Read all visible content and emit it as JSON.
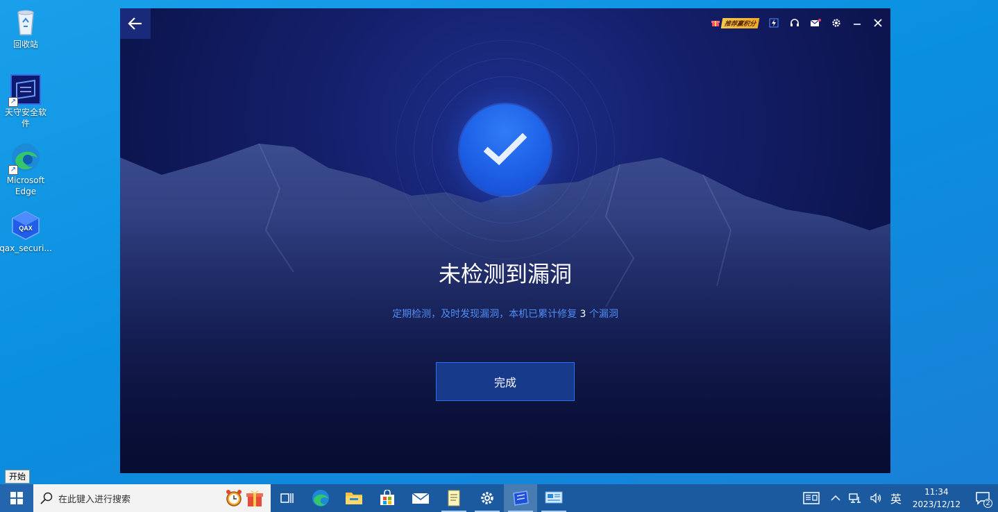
{
  "desktop": {
    "icons": [
      {
        "label": "回收站"
      },
      {
        "label": "天守安全软件"
      },
      {
        "label": "Microsoft Edge"
      },
      {
        "label": "qax_securi..."
      }
    ]
  },
  "app": {
    "promo_label": "推荐赢积分",
    "result_title": "未检测到漏洞",
    "subtitle_prefix": "定期检测，及时发现漏洞，本机已累计修复",
    "fixed_count": "3",
    "subtitle_suffix": "个漏洞",
    "done_button": "完成"
  },
  "taskbar": {
    "start_tooltip": "开始",
    "search_placeholder": "在此键入进行搜索",
    "ime_label": "英",
    "time": "11:34",
    "date": "2023/12/12",
    "notification_count": "2"
  },
  "colors": {
    "accent_blue": "#2f7cf6",
    "subtitle_blue": "#4e8df2",
    "app_bg": "#141f6a",
    "taskbar": "#1c5aa0"
  }
}
